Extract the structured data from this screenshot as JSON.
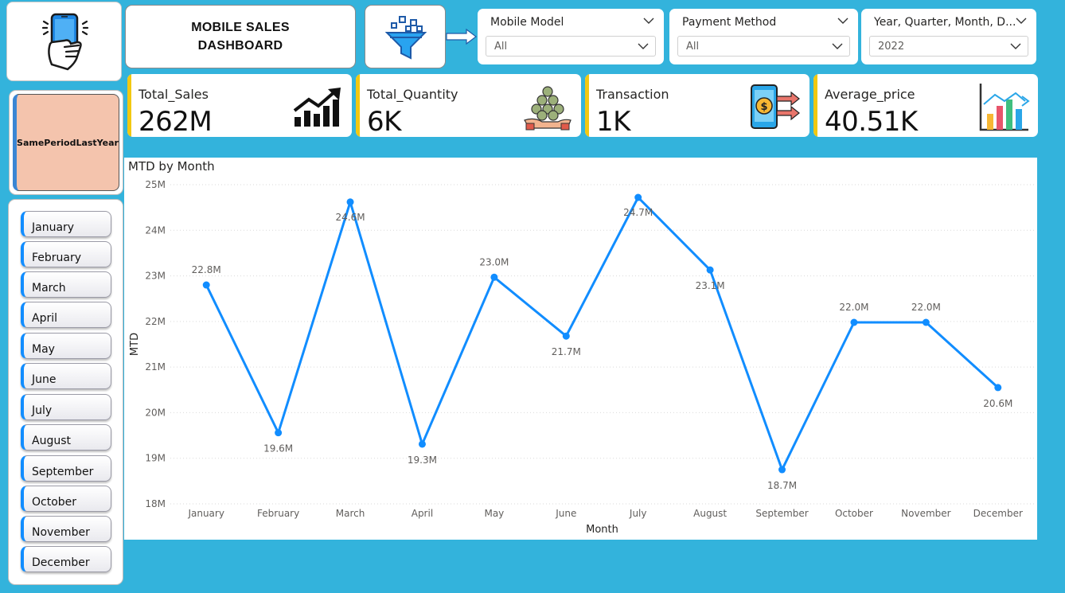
{
  "header": {
    "title_line1": "MOBILE SALES",
    "title_line2": "DASHBOARD"
  },
  "icons": {
    "logo": "phone-hand-icon",
    "filter": "funnel-icon",
    "arrow": "arrow-right-icon"
  },
  "slicers": {
    "mobile_model": {
      "label": "Mobile Model",
      "value": "All"
    },
    "payment_method": {
      "label": "Payment Method",
      "value": "All"
    },
    "date_hierarchy": {
      "label": "Year, Quarter, Month, D...",
      "value": "2022"
    }
  },
  "kpis": {
    "total_sales": {
      "name": "Total_Sales",
      "value": "262M",
      "icon": "trending-up-bars-icon"
    },
    "total_quantity": {
      "name": "Total_Quantity",
      "value": "6K",
      "icon": "coins-in-hand-icon"
    },
    "transaction": {
      "name": "Transaction",
      "value": "1K",
      "icon": "mobile-payment-icon"
    },
    "average_price": {
      "name": "Average_price",
      "value": "40.51K",
      "icon": "bar-chart-growth-icon"
    }
  },
  "sply_button": {
    "label": "SamePeriodLastYear"
  },
  "months": [
    "January",
    "February",
    "March",
    "April",
    "May",
    "June",
    "July",
    "August",
    "September",
    "October",
    "November",
    "December"
  ],
  "colors": {
    "background": "#33b3dc",
    "accent_line": "#118dff",
    "kpi_bar": "#f2c811",
    "sply_fill": "#f4c4ad"
  },
  "chart_data": {
    "type": "line",
    "title": "MTD by Month",
    "xlabel": "Month",
    "ylabel": "MTD",
    "categories": [
      "January",
      "February",
      "March",
      "April",
      "May",
      "June",
      "July",
      "August",
      "September",
      "October",
      "November",
      "December"
    ],
    "series": [
      {
        "values": [
          22.8,
          19.56,
          24.62,
          19.31,
          22.97,
          21.68,
          24.72,
          23.13,
          18.75,
          21.98,
          21.98,
          20.55
        ]
      }
    ],
    "data_labels": [
      "22.8M",
      "19.6M",
      "24.6M",
      "19.3M",
      "23.0M",
      "21.7M",
      "24.7M",
      "23.1M",
      "18.7M",
      "22.0M",
      "22.0M",
      "20.6M"
    ],
    "yticks": [
      "18M",
      "19M",
      "20M",
      "21M",
      "22M",
      "23M",
      "24M",
      "25M"
    ],
    "ylim": [
      18,
      25
    ],
    "grid": true
  }
}
